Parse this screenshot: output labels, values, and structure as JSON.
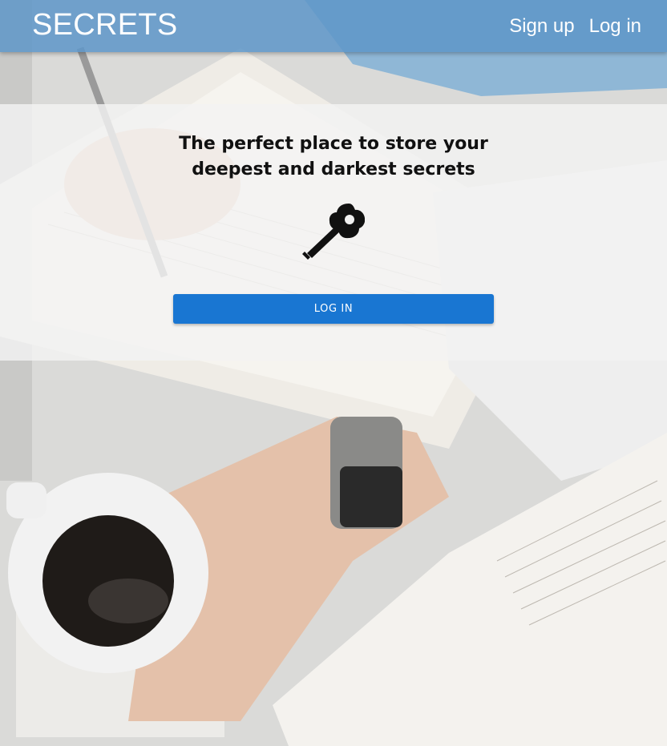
{
  "appbar": {
    "brand": "SECRETS",
    "links": [
      "Sign up",
      "Log in"
    ]
  },
  "hero": {
    "headline_line1": "The perfect place to store your",
    "headline_line2": "deepest and darkest secrets",
    "icon": "key-icon",
    "button_label": "LOG IN"
  },
  "colors": {
    "appbar": "#5e96c8",
    "button": "#1976d2",
    "panel": "#f3f3f3"
  }
}
